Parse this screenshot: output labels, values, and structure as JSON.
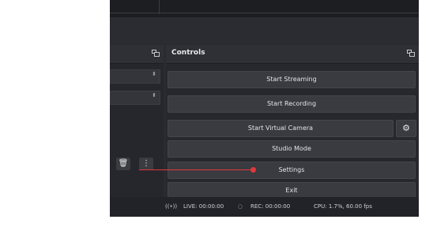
{
  "controls_dock": {
    "title": "Controls",
    "buttons": {
      "start_streaming": "Start Streaming",
      "start_recording": "Start Recording",
      "start_virtual_camera": "Start Virtual Camera",
      "studio_mode": "Studio Mode",
      "settings": "Settings",
      "exit": "Exit"
    }
  },
  "status_bar": {
    "live": "LIVE: 00:00:00",
    "rec": "REC: 00:00:00",
    "cpu": "CPU: 1.7%, 60.00 fps"
  },
  "icons": {
    "float": "undock-icon",
    "gear": "gear-icon",
    "trash": "trash-icon",
    "more": "more-vertical-icon",
    "live": "broadcast-icon",
    "rec": "record-icon"
  },
  "colors": {
    "panel": "#27282d",
    "button": "#3a3b41",
    "text": "#e3e4e6",
    "annotation": "#e0383b"
  }
}
